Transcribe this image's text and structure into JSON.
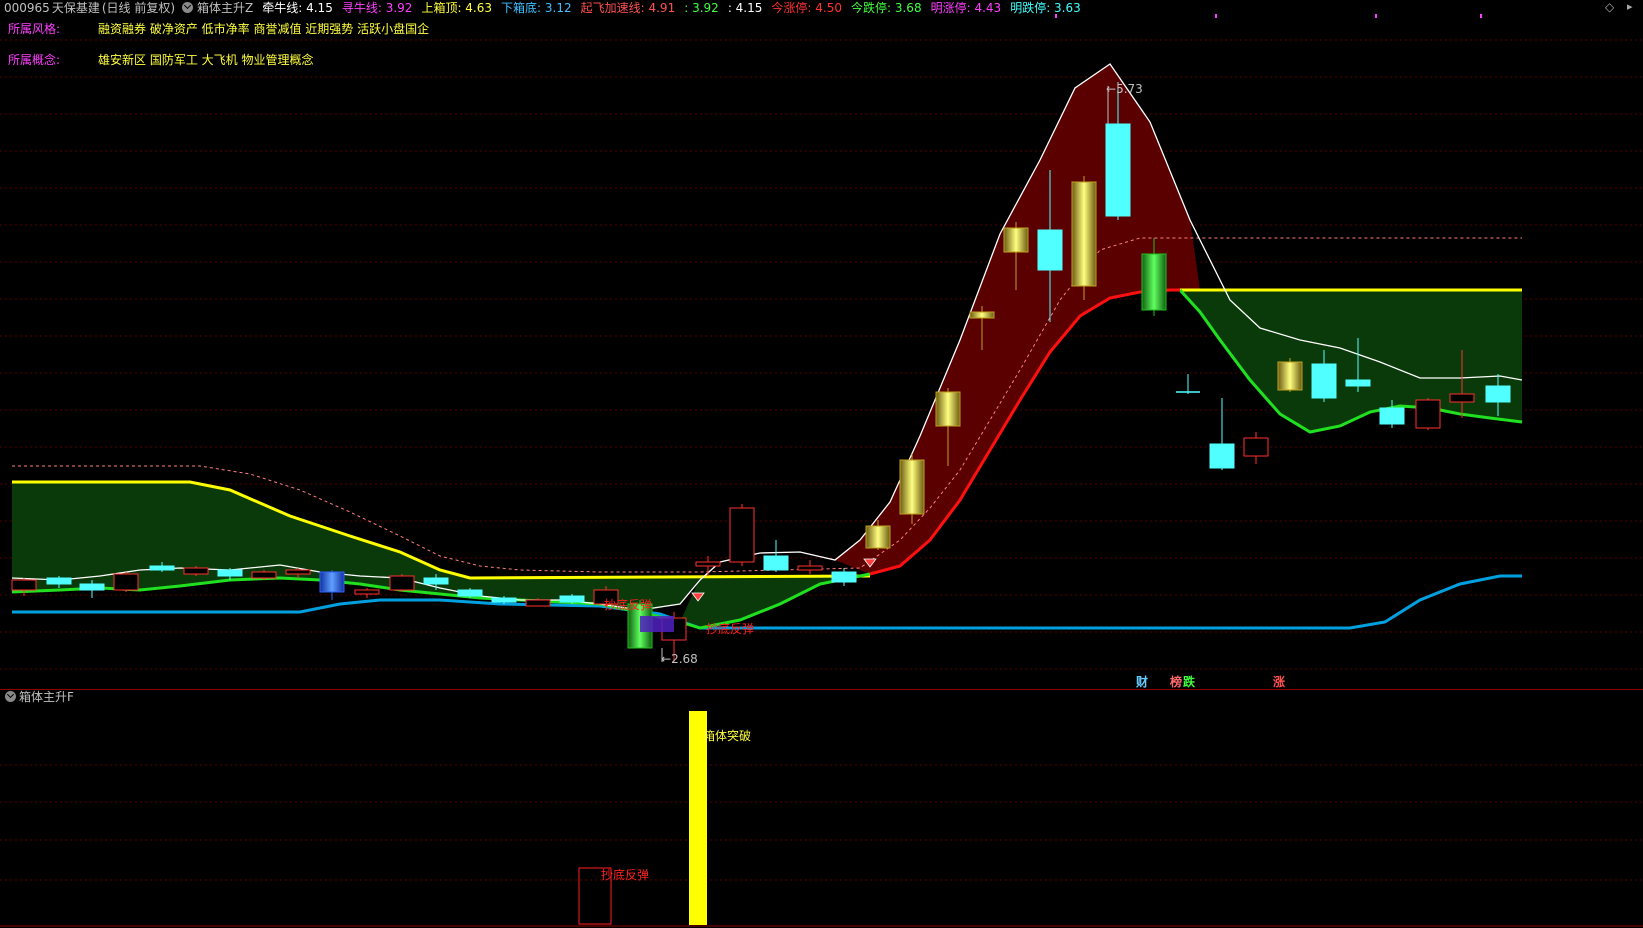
{
  "header": {
    "code": "000965",
    "name": "天保基建",
    "period": "(日线 前复权)",
    "indicator": "箱体主升Z",
    "items": [
      {
        "label": "牵牛线:",
        "value": "4.15",
        "color": "#ffffff",
        "vcolor": "#ffffff"
      },
      {
        "label": "寻牛线:",
        "value": "3.92",
        "color": "#ff40ff",
        "vcolor": "#ff40ff"
      },
      {
        "label": "上箱顶:",
        "value": "4.63",
        "color": "#ffff40",
        "vcolor": "#ffff40"
      },
      {
        "label": "下箱底:",
        "value": "3.12",
        "color": "#40c0ff",
        "vcolor": "#40c0ff"
      },
      {
        "label": "起飞加速线:",
        "value": "4.91",
        "color": "#ff5050",
        "vcolor": "#ff5050"
      },
      {
        "label": ":",
        "value": "3.92",
        "color": "#40ff40",
        "vcolor": "#40ff40"
      },
      {
        "label": ":",
        "value": "4.15",
        "color": "#ffffff",
        "vcolor": "#ffffff"
      },
      {
        "label": "今涨停:",
        "value": "4.50",
        "color": "#ff3030",
        "vcolor": "#ff3030"
      },
      {
        "label": "今跌停:",
        "value": "3.68",
        "color": "#40ff40",
        "vcolor": "#40ff40"
      },
      {
        "label": "明涨停:",
        "value": "4.43",
        "color": "#ff40ff",
        "vcolor": "#ff40ff"
      },
      {
        "label": "明跌停:",
        "value": "3.63",
        "color": "#40ffff",
        "vcolor": "#40ffff"
      }
    ]
  },
  "info": {
    "style_label": "所属风格:",
    "style_value": "融资融券 破净资产 低市净率 商誉减值 近期强势 活跃小盘国企",
    "concept_label": "所属概念:",
    "concept_value": "雄安新区 国防军工 大飞机 物业管理概念"
  },
  "annotations": {
    "high_price": "5.73",
    "low_price": "2.68",
    "signal_rebound_1": "抄底反弹",
    "signal_rebound_2": "抄底反弹",
    "event_cai": "财",
    "event_bang": "榜",
    "event_die": "跌",
    "event_zhang": "涨"
  },
  "sub": {
    "indicator": "箱体主升F",
    "label_breakout": "箱体突破",
    "label_rebound": "抄底反弹"
  },
  "colors": {
    "background": "#000000",
    "grid": "#5a0000",
    "box_top": "#ffff00",
    "box_bottom": "#00a0e0",
    "green_line": "#20e020",
    "red_line": "#ff1010",
    "white_line": "#ffffff",
    "green_fill": "#0a3a0a",
    "red_fill": "#5a0000",
    "candle_up": "#ff3030",
    "candle_down": "#50ffff",
    "bar_yellow": "#ffff00"
  }
}
